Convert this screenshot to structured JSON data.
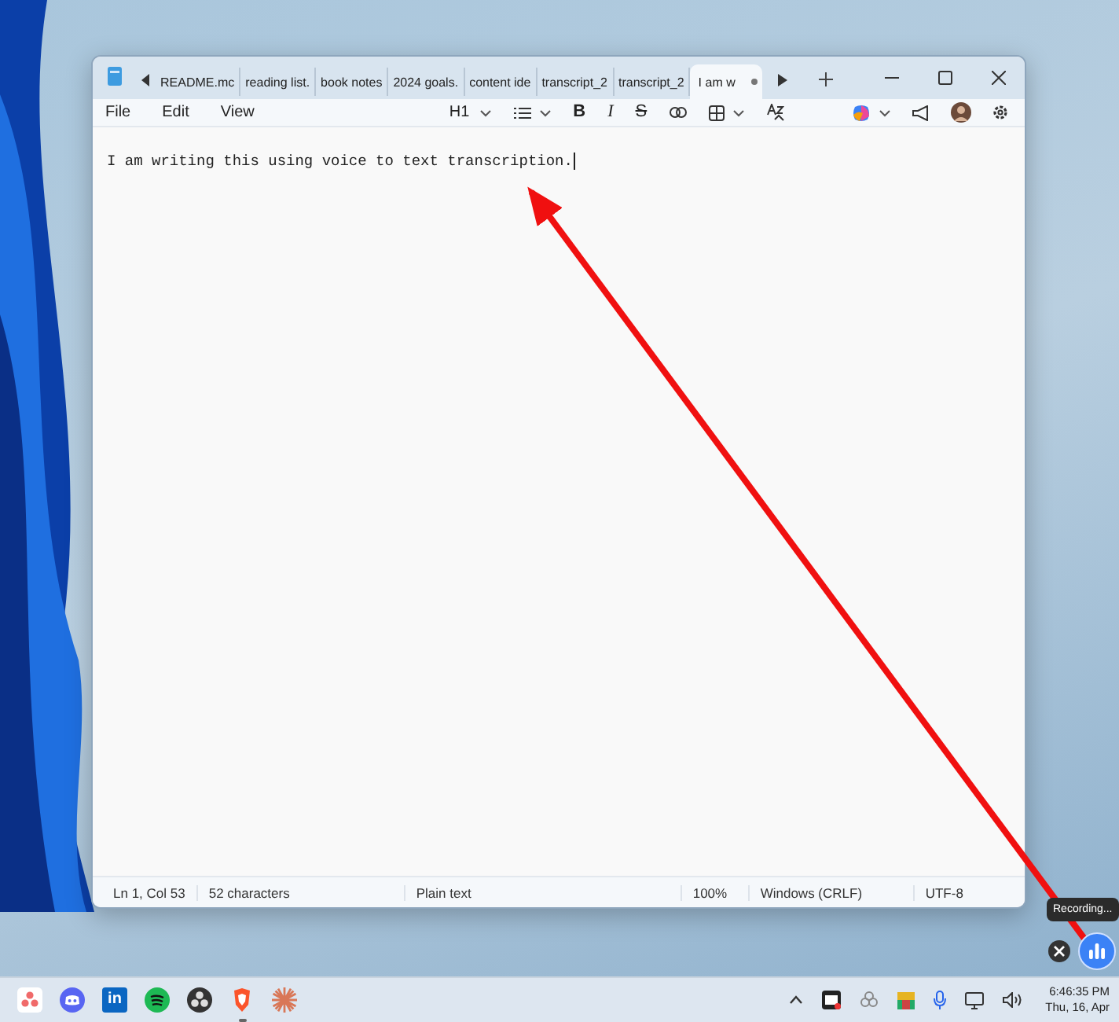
{
  "window": {
    "tabs": [
      {
        "label": "README.mc",
        "selected": false,
        "modified": false
      },
      {
        "label": "reading list.",
        "selected": false,
        "modified": false
      },
      {
        "label": "book notes",
        "selected": false,
        "modified": false
      },
      {
        "label": "2024 goals.",
        "selected": false,
        "modified": false
      },
      {
        "label": "content ide",
        "selected": false,
        "modified": false
      },
      {
        "label": "transcript_2",
        "selected": false,
        "modified": false
      },
      {
        "label": "transcript_2",
        "selected": false,
        "modified": false
      },
      {
        "label": "I am w",
        "selected": true,
        "modified": true
      }
    ]
  },
  "menu": [
    "File",
    "Edit",
    "View"
  ],
  "toolbar": {
    "heading": "H1",
    "format": [
      {
        "kind": "bold",
        "label": "B"
      },
      {
        "kind": "italic",
        "label": "I"
      },
      {
        "kind": "strike",
        "label": "S"
      }
    ]
  },
  "document": {
    "text": "I am writing this using voice to text transcription."
  },
  "status_bar": [
    "Ln 1, Col 53",
    "52 characters",
    "Plain text",
    "100%",
    "Windows (CRLF)",
    "UTF-8"
  ],
  "recording": {
    "tooltip": "Recording..."
  },
  "taskbar": {
    "apps": [
      {
        "kind": "dots",
        "running": false
      },
      {
        "kind": "controller",
        "running": false
      },
      {
        "kind": "badge",
        "label": "in",
        "running": false
      },
      {
        "kind": "waves",
        "running": false
      },
      {
        "kind": "disc",
        "running": false
      },
      {
        "kind": "shield",
        "running": true
      },
      {
        "kind": "burst",
        "running": false
      }
    ],
    "clock": {
      "time": "6:46:35 PM",
      "date": "Thu, 16, Apr"
    }
  }
}
